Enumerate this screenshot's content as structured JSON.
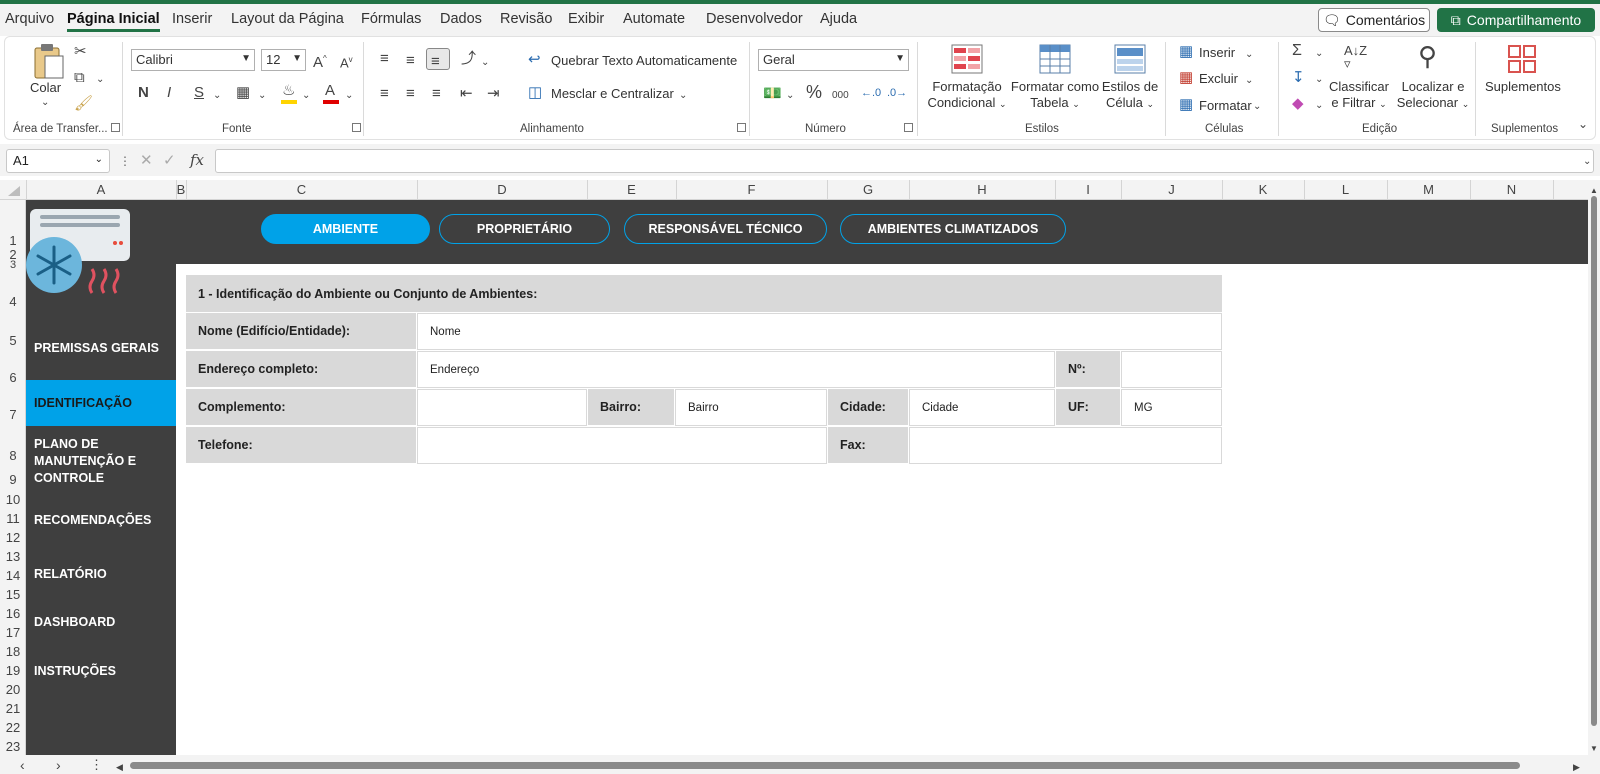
{
  "menu": {
    "items": [
      "Arquivo",
      "Página Inicial",
      "Inserir",
      "Layout da Página",
      "Fórmulas",
      "Dados",
      "Revisão",
      "Exibir",
      "Automate",
      "Desenvolvedor",
      "Ajuda"
    ],
    "active": "Página Inicial",
    "comments_label": "Comentários",
    "share_label": "Compartilhamento"
  },
  "ribbon": {
    "clipboard": {
      "paste_label": "Colar",
      "group_label": "Área de Transfer..."
    },
    "font": {
      "name": "Calibri",
      "size": "12",
      "bold": "N",
      "italic": "I",
      "underline": "S",
      "group_label": "Fonte",
      "highlight_color": "#ffd400",
      "font_color": "#e00000"
    },
    "alignment": {
      "wrap_label": "Quebrar Texto Automaticamente",
      "merge_label": "Mesclar e Centralizar",
      "group_label": "Alinhamento"
    },
    "number": {
      "format": "Geral",
      "group_label": "Número",
      "percent": "%",
      "thousands": "000"
    },
    "styles": {
      "cond_format_line1": "Formatação",
      "cond_format_line2": "Condicional",
      "table_line1": "Formatar como",
      "table_line2": "Tabela",
      "cell_styles_line1": "Estilos de",
      "cell_styles_line2": "Célula",
      "group_label": "Estilos"
    },
    "cells": {
      "insert_label": "Inserir",
      "delete_label": "Excluir",
      "format_label": "Formatar",
      "group_label": "Células"
    },
    "editing": {
      "sort_line1": "Classificar",
      "sort_line2": "e Filtrar",
      "find_line1": "Localizar e",
      "find_line2": "Selecionar",
      "group_label": "Edição"
    },
    "addins": {
      "label": "Suplementos",
      "group_label": "Suplementos"
    }
  },
  "formula_bar": {
    "name_box": "A1",
    "fx": "fx",
    "value": ""
  },
  "columns": [
    "A",
    "B",
    "C",
    "D",
    "E",
    "F",
    "G",
    "H",
    "I",
    "J",
    "K",
    "L",
    "M",
    "N"
  ],
  "rows": [
    "1",
    "2",
    "3",
    "4",
    "5",
    "6",
    "7",
    "8",
    "9",
    "10",
    "11",
    "12",
    "13",
    "14",
    "15",
    "16",
    "17",
    "18",
    "19",
    "20",
    "21",
    "22",
    "23"
  ],
  "sheet": {
    "top_nav": [
      {
        "label": "AMBIENTE",
        "active": true
      },
      {
        "label": "PROPRIETÁRIO",
        "active": false
      },
      {
        "label": "RESPONSÁVEL TÉCNICO",
        "active": false
      },
      {
        "label": "AMBIENTES CLIMATIZADOS",
        "active": false
      }
    ],
    "side_nav": [
      "PREMISSAS GERAIS",
      "IDENTIFICAÇÃO",
      "PLANO DE MANUTENÇÃO E CONTROLE",
      "RECOMENDAÇÕES",
      "RELATÓRIO",
      "DASHBOARD",
      "INSTRUÇÕES"
    ],
    "side_nav_active": "IDENTIFICAÇÃO",
    "form": {
      "section_title": "1 - Identificação do Ambiente ou Conjunto de Ambientes:",
      "name_label": "Nome (Edifício/Entidade):",
      "name_value": "Nome",
      "address_label": "Endereço completo:",
      "address_value": "Endereço",
      "number_label": "Nº:",
      "number_value": "",
      "complement_label": "Complemento:",
      "complement_value": "",
      "district_label": "Bairro:",
      "district_value": "Bairro",
      "city_label": "Cidade:",
      "city_value": "Cidade",
      "uf_label": "UF:",
      "uf_value": "MG",
      "phone_label": "Telefone:",
      "phone_value": "",
      "fax_label": "Fax:",
      "fax_value": ""
    },
    "colors": {
      "dark": "#3f3f3f",
      "accent": "#00a2e8",
      "label_bg": "#d9d9d9"
    }
  }
}
